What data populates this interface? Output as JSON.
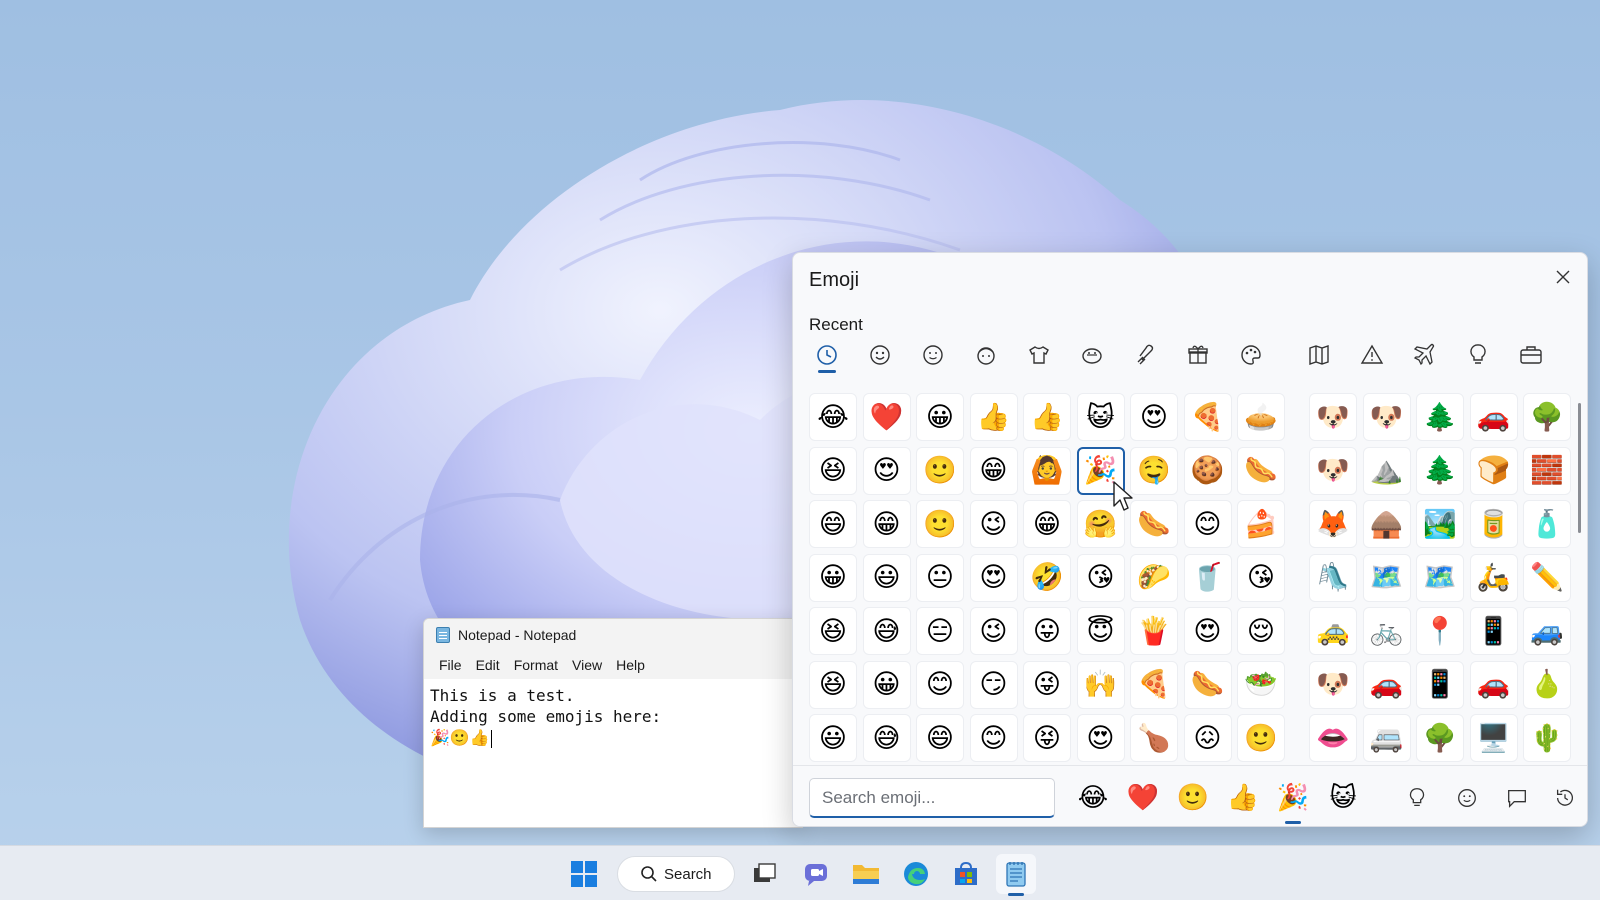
{
  "desktop": {
    "wallpaper": "windows-11-bloom-lavender"
  },
  "notepad": {
    "title": "Notepad - Notepad",
    "menu": [
      "File",
      "Edit",
      "Format",
      "View",
      "Help"
    ],
    "lines": [
      "This is a test.",
      "Adding some emojis here:",
      "🎉🙂👍"
    ]
  },
  "emoji_panel": {
    "title": "Emoji",
    "section": "Recent",
    "close_icon": "close-icon",
    "tabs": [
      {
        "name": "recent",
        "icon": "clock-icon",
        "active": true
      },
      {
        "name": "smileys",
        "icon": "smiley-icon"
      },
      {
        "name": "faces",
        "icon": "smiley-outline-icon"
      },
      {
        "name": "people",
        "icon": "person-face-icon"
      },
      {
        "name": "clothing",
        "icon": "tshirt-icon"
      },
      {
        "name": "animals",
        "icon": "cat-face-icon"
      },
      {
        "name": "food",
        "icon": "drumstick-icon"
      },
      {
        "name": "celebration",
        "icon": "gift-icon"
      },
      {
        "name": "activities",
        "icon": "palette-icon"
      },
      {
        "name": "places",
        "icon": "map-icon"
      },
      {
        "name": "symbols",
        "icon": "warning-icon"
      },
      {
        "name": "travel",
        "icon": "airplane-icon"
      },
      {
        "name": "objects",
        "icon": "lightbulb-icon"
      },
      {
        "name": "work",
        "icon": "briefcase-icon"
      }
    ],
    "grid_left": [
      [
        "😂",
        "❤️",
        "😀",
        "👍",
        "👍",
        "😺",
        "😍",
        "🍕",
        "🥧"
      ],
      [
        "😆",
        "😍",
        "🙂",
        "😁",
        "🙆",
        "🎉",
        "🤤",
        "🍪",
        "🌭"
      ],
      [
        "😄",
        "😁",
        "🙂",
        "😉",
        "😁",
        "🤗",
        "🌭",
        "😊",
        "🍰"
      ],
      [
        "😀",
        "😃",
        "😐",
        "😍",
        "🤣",
        "😘",
        "🌮",
        "🥤",
        "😘"
      ],
      [
        "😆",
        "😅",
        "😑",
        "😉",
        "😛",
        "😇",
        "🍟",
        "😍",
        "😌"
      ],
      [
        "😆",
        "😀",
        "😊",
        "😏",
        "😜",
        "🙌",
        "🍕",
        "🌭",
        "🥗"
      ],
      [
        "😃",
        "😅",
        "😄",
        "😊",
        "😝",
        "😍",
        "🍗",
        "😖",
        "🙂"
      ]
    ],
    "grid_right": [
      [
        "🐶",
        "🐶",
        "🌲",
        "🚗",
        "🌳"
      ],
      [
        "🐶",
        "⛰️",
        "🌲",
        "🍞",
        "🧱"
      ],
      [
        "🦊",
        "🛖",
        "🏞️",
        "🥫",
        "🧴"
      ],
      [
        "🛝",
        "🗺️",
        "🗺️",
        "🛵",
        "✏️"
      ],
      [
        "🚕",
        "🚲",
        "📍",
        "📱",
        "🚙"
      ],
      [
        "🐶",
        "🚗",
        "📱",
        "🚗",
        "🍐"
      ],
      [
        "👄",
        "🚐",
        "🌳",
        "🖥️",
        "🌵"
      ]
    ],
    "selected": {
      "row": 1,
      "col": 5
    },
    "search": {
      "placeholder": "Search emoji...",
      "value": ""
    },
    "favorites": [
      "😂",
      "❤️",
      "🙂",
      "👍",
      "🎉",
      "😺"
    ],
    "footer_tabs": [
      {
        "icon": "lightbulb-icon"
      },
      {
        "icon": "smiley-outline-icon"
      },
      {
        "icon": "speech-bubble-icon"
      },
      {
        "icon": "history-icon"
      }
    ]
  },
  "taskbar": {
    "search_label": "Search",
    "items": [
      "start-icon",
      "task-view-icon",
      "chat-icon",
      "file-explorer-icon",
      "edge-icon",
      "store-icon",
      "notepad-icon"
    ]
  },
  "colors": {
    "accent": "#1f5fa8",
    "taskbar": "#e7ebf2",
    "panel": "#f8f9fb"
  }
}
